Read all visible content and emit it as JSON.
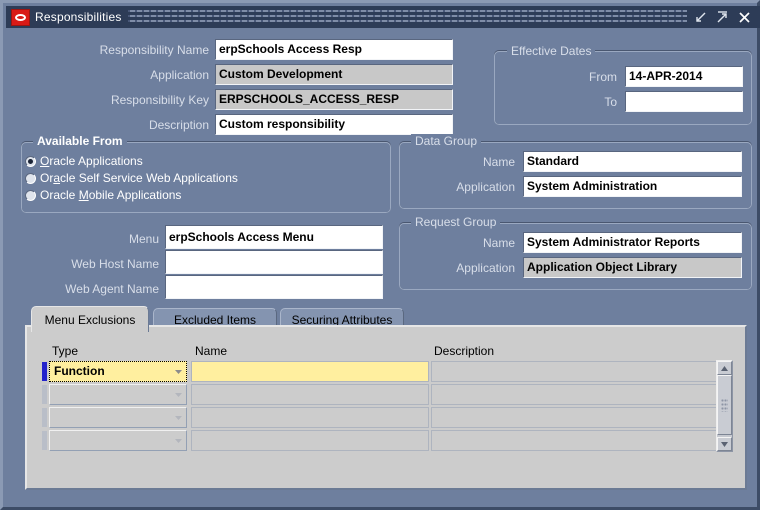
{
  "window": {
    "title": "Responsibilities",
    "icon": "oracle-logo-icon",
    "controls": {
      "minimize": "minimize-icon",
      "maximize": "maximize-icon",
      "close": "close-icon"
    }
  },
  "header_fields": [
    {
      "label": "Responsibility Name",
      "value": "erpSchools Access Resp",
      "readonly": false
    },
    {
      "label": "Application",
      "value": "Custom Development",
      "readonly": true
    },
    {
      "label": "Responsibility Key",
      "value": "ERPSCHOOLS_ACCESS_RESP",
      "readonly": true
    },
    {
      "label": "Description",
      "value": "Custom responsibility",
      "readonly": false
    }
  ],
  "effective_dates": {
    "title": "Effective Dates",
    "from_label": "From",
    "from_value": "14-APR-2014",
    "to_label": "To",
    "to_value": ""
  },
  "available_from": {
    "title": "Available From",
    "options": [
      {
        "label": "Oracle Applications",
        "mnemonic": "O",
        "selected": true
      },
      {
        "label": "Oracle Self Service Web Applications",
        "mnemonic": "a",
        "selected": false
      },
      {
        "label": "Oracle Mobile Applications",
        "mnemonic": "M",
        "selected": false
      }
    ]
  },
  "data_group": {
    "title": "Data Group",
    "name_label": "Name",
    "name_value": "Standard",
    "application_label": "Application",
    "application_value": "System Administration"
  },
  "request_group": {
    "title": "Request Group",
    "name_label": "Name",
    "name_value": "System Administrator Reports",
    "application_label": "Application",
    "application_value": "Application Object Library"
  },
  "menu_fields": [
    {
      "label": "Menu",
      "value": "erpSchools Access Menu"
    },
    {
      "label": "Web Host Name",
      "value": ""
    },
    {
      "label": "Web Agent Name",
      "value": ""
    }
  ],
  "tabs": [
    {
      "label": "Menu Exclusions",
      "active": true
    },
    {
      "label": "Excluded Items",
      "active": false
    },
    {
      "label": "Securing Attributes",
      "active": false
    }
  ],
  "grid": {
    "columns": [
      {
        "label": "Type"
      },
      {
        "label": "Name"
      },
      {
        "label": "Description"
      }
    ],
    "rows": [
      {
        "type": "Function",
        "name": "",
        "description": "",
        "current": true
      },
      {
        "type": "",
        "name": "",
        "description": "",
        "current": false
      },
      {
        "type": "",
        "name": "",
        "description": "",
        "current": false
      },
      {
        "type": "",
        "name": "",
        "description": "",
        "current": false
      }
    ]
  },
  "colors": {
    "window_bg": "#6e7f9e",
    "titlebar_bg": "#2d3c57",
    "field_bg": "#ffffff",
    "readonly_bg": "#c8c8c8",
    "tab_panel_bg": "#cccccc",
    "focus_cell_bg": "#ffef9f",
    "record_indicator": "#2222cc",
    "oracle_red": "#d91a17"
  }
}
